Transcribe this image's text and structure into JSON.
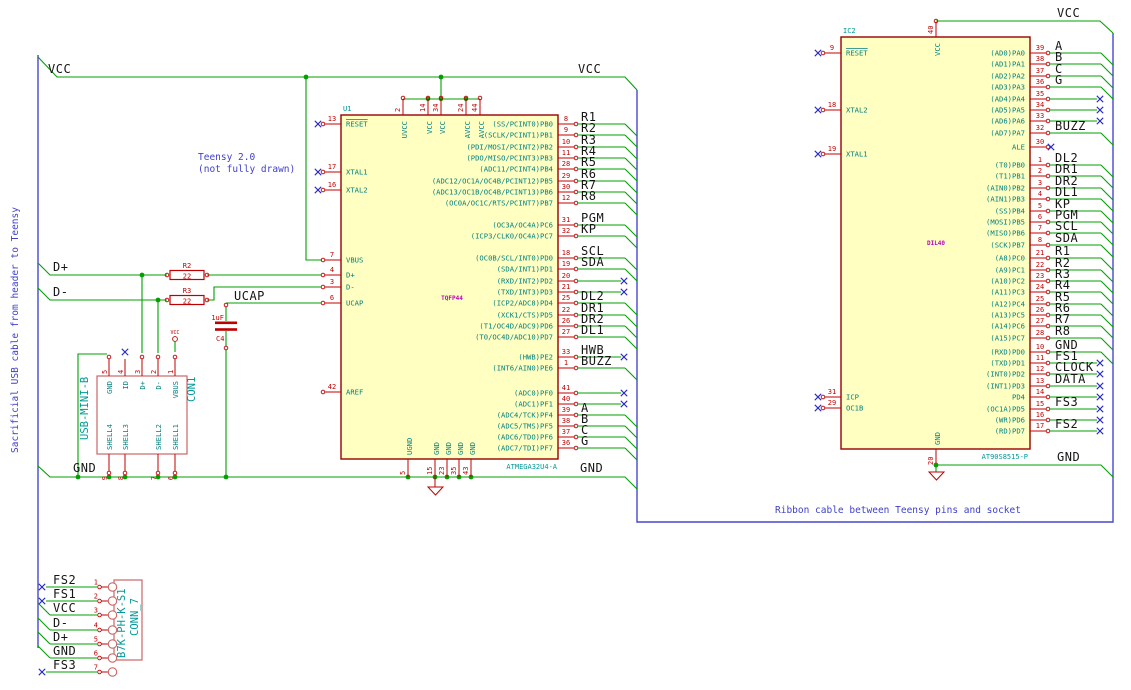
{
  "notes": {
    "teensy_line1": "Teensy 2.0",
    "teensy_line2": "(not fully drawn)",
    "left_cable": "Sacrificial USB cable from header to Teensy",
    "ribbon_cable": "Ribbon cable between Teensy pins and socket"
  },
  "rail_labels": {
    "vcc_left": "VCC",
    "vcc_u1": "VCC",
    "gnd_left": "GND",
    "gnd_u1": "GND",
    "vcc_ic2": "VCC",
    "gnd_ic2": "GND",
    "dplus": "D+",
    "dminus": "D-",
    "ucap": "UCAP"
  },
  "components": {
    "u1": {
      "ref": "U1",
      "value": "ATMEGA32U4-A",
      "footprint": "TQFP44",
      "right_pins": [
        {
          "num": "8",
          "name": "(SS/PCINT0)PB0",
          "net": "R1",
          "conn": "cable"
        },
        {
          "num": "9",
          "name": "(SCLK/PCINT1)PB1",
          "net": "R2",
          "conn": "cable"
        },
        {
          "num": "10",
          "name": "(PDI/MOSI/PCINT2)PB2",
          "net": "R3",
          "conn": "cable"
        },
        {
          "num": "11",
          "name": "(PDO/MISO/PCINT3)PB3",
          "net": "R4",
          "conn": "cable"
        },
        {
          "num": "28",
          "name": "(ADC11/PCINT4)PB4",
          "net": "R5",
          "conn": "cable"
        },
        {
          "num": "29",
          "name": "(ADC12/OC1A/OC4B/PCINT12)PB5",
          "net": "R6",
          "conn": "cable"
        },
        {
          "num": "30",
          "name": "(ADC13/OC1B/OC4B/PCINT13)PB6",
          "net": "R7",
          "conn": "cable"
        },
        {
          "num": "12",
          "name": "(OC0A/OC1C/RTS/PCINT7)PB7",
          "net": "R8",
          "conn": "cable"
        },
        {
          "num": "31",
          "name": "(OC3A/OC4A)PC6",
          "net": "PGM",
          "conn": "cable"
        },
        {
          "num": "32",
          "name": "(ICP3/CLK0/OC4A)PC7",
          "net": "KP",
          "conn": "cable"
        },
        {
          "num": "18",
          "name": "(OC0B/SCL/INT0)PD0",
          "net": "SCL",
          "conn": "cable"
        },
        {
          "num": "19",
          "name": "(SDA/INT1)PD1",
          "net": "SDA",
          "conn": "cable"
        },
        {
          "num": "20",
          "name": "(RXD/INT2)PD2",
          "net": "",
          "conn": "nc"
        },
        {
          "num": "21",
          "name": "(TXD/INT3)PD3",
          "net": "",
          "conn": "nc"
        },
        {
          "num": "25",
          "name": "(ICP2/ADC8)PD4",
          "net": "DL2",
          "conn": "cable"
        },
        {
          "num": "22",
          "name": "(XCK1/CTS)PD5",
          "net": "DR1",
          "conn": "cable"
        },
        {
          "num": "26",
          "name": "(T1/OC4D/ADC9)PD6",
          "net": "DR2",
          "conn": "cable"
        },
        {
          "num": "27",
          "name": "(T0/OC4D/ADC10)PD7",
          "net": "DL1",
          "conn": "cable"
        },
        {
          "num": "33",
          "name": "(HWB)PE2",
          "net": "HWB",
          "conn": "nc"
        },
        {
          "num": "1",
          "name": "(INT6/AIN0)PE6",
          "net": "BUZZ",
          "conn": "cable"
        },
        {
          "num": "41",
          "name": "(ADC0)PF0",
          "net": "",
          "conn": "nc"
        },
        {
          "num": "40",
          "name": "(ADC1)PF1",
          "net": "",
          "conn": "nc"
        },
        {
          "num": "39",
          "name": "(ADC4/TCK)PF4",
          "net": "A",
          "conn": "cable"
        },
        {
          "num": "38",
          "name": "(ADC5/TMS)PF5",
          "net": "B",
          "conn": "cable"
        },
        {
          "num": "37",
          "name": "(ADC6/TDO)PF6",
          "net": "C",
          "conn": "cable"
        },
        {
          "num": "36",
          "name": "(ADC7/TDI)PF7",
          "net": "G",
          "conn": "cable"
        }
      ],
      "left_pins": [
        {
          "num": "13",
          "name": "RESET",
          "conn": "ncshort",
          "overline": true
        },
        {
          "num": "17",
          "name": "XTAL1",
          "conn": "ncshort"
        },
        {
          "num": "16",
          "name": "XTAL2",
          "conn": "ncshort"
        },
        {
          "num": "7",
          "name": "VBUS",
          "conn": "plain"
        },
        {
          "num": "4",
          "name": "D+",
          "conn": "plain"
        },
        {
          "num": "3",
          "name": "D-",
          "conn": "plain"
        },
        {
          "num": "6",
          "name": "UCAP",
          "conn": "plain"
        },
        {
          "num": "42",
          "name": "AREF",
          "conn": "plain"
        }
      ],
      "top_pins": [
        {
          "num": "2",
          "name": "UVCC"
        },
        {
          "num": "14",
          "name": "VCC"
        },
        {
          "num": "34",
          "name": "VCC"
        },
        {
          "num": "24",
          "name": "AVCC"
        },
        {
          "num": "44",
          "name": "AVCC"
        }
      ],
      "bottom_pins": [
        {
          "num": "5",
          "name": "UGND"
        },
        {
          "num": "15",
          "name": "GND"
        },
        {
          "num": "23",
          "name": "GND"
        },
        {
          "num": "35",
          "name": "GND"
        },
        {
          "num": "43",
          "name": "GND"
        }
      ]
    },
    "ic2": {
      "ref": "IC2",
      "value": "AT90S8515-P",
      "footprint": "DIL40",
      "right_pins": [
        {
          "num": "39",
          "name": "(AD0)PA0",
          "net": "A",
          "conn": "cable"
        },
        {
          "num": "38",
          "name": "(AD1)PA1",
          "net": "B",
          "conn": "cable"
        },
        {
          "num": "37",
          "name": "(AD2)PA2",
          "net": "C",
          "conn": "cable"
        },
        {
          "num": "36",
          "name": "(AD3)PA3",
          "net": "G",
          "conn": "cable"
        },
        {
          "num": "35",
          "name": "(AD4)PA4",
          "net": "",
          "conn": "nc"
        },
        {
          "num": "34",
          "name": "(AD5)PA5",
          "net": "",
          "conn": "nc"
        },
        {
          "num": "33",
          "name": "(AD6)PA6",
          "net": "",
          "conn": "nc"
        },
        {
          "num": "32",
          "name": "(AD7)PA7",
          "net": "BUZZ",
          "conn": "cable"
        },
        {
          "num": "30",
          "name": "ALE",
          "net": "",
          "conn": "ncshort"
        },
        {
          "num": "1",
          "name": "(T0)PB0",
          "net": "DL2",
          "conn": "cable"
        },
        {
          "num": "2",
          "name": "(T1)PB1",
          "net": "DR1",
          "conn": "cable"
        },
        {
          "num": "3",
          "name": "(AIN0)PB2",
          "net": "DR2",
          "conn": "cable"
        },
        {
          "num": "4",
          "name": "(AIN1)PB3",
          "net": "DL1",
          "conn": "cable"
        },
        {
          "num": "5",
          "name": "(SS)PB4",
          "net": "KP",
          "conn": "cable"
        },
        {
          "num": "6",
          "name": "(MOSI)PB5",
          "net": "PGM",
          "conn": "cable"
        },
        {
          "num": "7",
          "name": "(MISO)PB6",
          "net": "SCL",
          "conn": "cable"
        },
        {
          "num": "8",
          "name": "(SCK)PB7",
          "net": "SDA",
          "conn": "cable"
        },
        {
          "num": "21",
          "name": "(A8)PC0",
          "net": "R1",
          "conn": "cable"
        },
        {
          "num": "22",
          "name": "(A9)PC1",
          "net": "R2",
          "conn": "cable"
        },
        {
          "num": "23",
          "name": "(A10)PC2",
          "net": "R3",
          "conn": "cable"
        },
        {
          "num": "24",
          "name": "(A11)PC3",
          "net": "R4",
          "conn": "cable"
        },
        {
          "num": "25",
          "name": "(A12)PC4",
          "net": "R5",
          "conn": "cable"
        },
        {
          "num": "26",
          "name": "(A13)PC5",
          "net": "R6",
          "conn": "cable"
        },
        {
          "num": "27",
          "name": "(A14)PC6",
          "net": "R7",
          "conn": "cable"
        },
        {
          "num": "28",
          "name": "(A15)PC7",
          "net": "R8",
          "conn": "cable"
        },
        {
          "num": "10",
          "name": "(RXD)PD0",
          "net": "GND",
          "conn": "cable"
        },
        {
          "num": "11",
          "name": "(TXD)PD1",
          "net": "FS1",
          "conn": "nc"
        },
        {
          "num": "12",
          "name": "(INT0)PD2",
          "net": "CLOCK",
          "conn": "nc"
        },
        {
          "num": "13",
          "name": "(INT1)PD3",
          "net": "DATA",
          "conn": "nc"
        },
        {
          "num": "14",
          "name": "PD4",
          "net": "",
          "conn": "nc"
        },
        {
          "num": "15",
          "name": "(OC1A)PD5",
          "net": "FS3",
          "conn": "nc"
        },
        {
          "num": "16",
          "name": "(WR)PD6",
          "net": "",
          "conn": "nc"
        },
        {
          "num": "17",
          "name": "(RD)PD7",
          "net": "FS2",
          "conn": "nc"
        }
      ],
      "left_pins": [
        {
          "num": "9",
          "name": "RESET",
          "conn": "ncshort",
          "overline": true
        },
        {
          "num": "18",
          "name": "XTAL2",
          "conn": "ncshort"
        },
        {
          "num": "19",
          "name": "XTAL1",
          "conn": "ncshort"
        },
        {
          "num": "31",
          "name": "ICP",
          "conn": "ncshort"
        },
        {
          "num": "29",
          "name": "OC1B",
          "conn": "ncshort"
        }
      ],
      "top_pins": [
        {
          "num": "40",
          "name": "VCC"
        }
      ],
      "bottom_pins": [
        {
          "num": "20",
          "name": "GND"
        }
      ]
    },
    "con1": {
      "ref": "CON1",
      "value": "USB-MINI-B",
      "top_pins": [
        {
          "num": "5",
          "name": "GND",
          "conn": "wire"
        },
        {
          "num": "4",
          "name": "ID",
          "conn": "nc"
        },
        {
          "num": "3",
          "name": "D+",
          "conn": "wire"
        },
        {
          "num": "2",
          "name": "D-",
          "conn": "wire"
        },
        {
          "num": "1",
          "name": "VBUS",
          "conn": "wire"
        }
      ],
      "bottom_pins": [
        {
          "num": "9",
          "name": "SHELL4"
        },
        {
          "num": "8",
          "name": "SHELL3"
        },
        {
          "num": "7",
          "name": "SHELL2"
        },
        {
          "num": "6",
          "name": "SHELL1"
        }
      ]
    },
    "conn7": {
      "ref": "CONN_7",
      "value": "B7K-PH-K-S1",
      "pins": [
        {
          "num": "1",
          "net": "FS2",
          "conn": "nc"
        },
        {
          "num": "2",
          "net": "FS1",
          "conn": "nc"
        },
        {
          "num": "3",
          "net": "VCC",
          "conn": "cable"
        },
        {
          "num": "4",
          "net": "D-",
          "conn": "cable"
        },
        {
          "num": "5",
          "net": "D+",
          "conn": "cable"
        },
        {
          "num": "6",
          "net": "GND",
          "conn": "cable"
        },
        {
          "num": "7",
          "net": "FS3",
          "conn": "nc"
        }
      ]
    },
    "r2": {
      "ref": "R2",
      "value": "22"
    },
    "r3": {
      "ref": "R3",
      "value": "22"
    },
    "c4": {
      "ref": "C4",
      "value": "1uF"
    },
    "pwr_con1": {
      "label": "VCC"
    }
  }
}
